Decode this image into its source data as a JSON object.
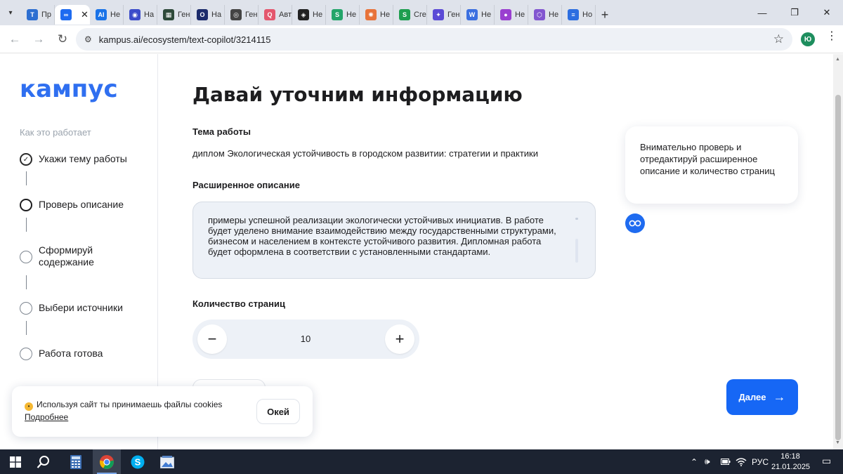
{
  "browser": {
    "tabs": [
      {
        "label": "Пр",
        "icon": "T",
        "color": "#2d6fd1"
      },
      {
        "label": "",
        "icon": "∞",
        "color": "#1e6bf0",
        "active": true
      },
      {
        "label": "Не",
        "icon": "AI",
        "color": "#1a73e8"
      },
      {
        "label": "На",
        "icon": "◉",
        "color": "#3b4cca"
      },
      {
        "label": "Ген",
        "icon": "▦",
        "color": "#2e4a3a"
      },
      {
        "label": "На",
        "icon": "O",
        "color": "#1c2b6b"
      },
      {
        "label": "Ген",
        "icon": "◎",
        "color": "#444444"
      },
      {
        "label": "Авт",
        "icon": "Q",
        "color": "#e4576e"
      },
      {
        "label": "Не",
        "icon": "◈",
        "color": "#222222"
      },
      {
        "label": "Не",
        "icon": "S",
        "color": "#24a56a"
      },
      {
        "label": "Не",
        "icon": "✺",
        "color": "#e8733a"
      },
      {
        "label": "Сге",
        "icon": "S",
        "color": "#1e9e4f"
      },
      {
        "label": "Ген",
        "icon": "✦",
        "color": "#5b4ad6"
      },
      {
        "label": "Не",
        "icon": "W",
        "color": "#3b6fe0"
      },
      {
        "label": "Не",
        "icon": "●",
        "color": "#9a3fd0"
      },
      {
        "label": "Не",
        "icon": "⬡",
        "color": "#8256d0"
      },
      {
        "label": "Но",
        "icon": "≡",
        "color": "#2d6ee0"
      }
    ],
    "url": "kampus.ai/ecosystem/text-copilot/3214115",
    "profile_initial": "Ю"
  },
  "sidebar": {
    "logo": "кампус",
    "how_it_works": "Как это работает",
    "steps": [
      {
        "label": "Укажи тему работы",
        "done": true
      },
      {
        "label": "Проверь описание",
        "current": true
      },
      {
        "label": "Сформируй содержание"
      },
      {
        "label": "Выбери источники"
      },
      {
        "label": "Работа готова"
      }
    ]
  },
  "main": {
    "title": "Давай уточним информацию",
    "topic_label": "Тема работы",
    "topic_value": "диплом Экологическая устойчивость в городском развитии: стратегии и практики",
    "description_label": "Расширенное описание",
    "description_text": "примеры успешной реализации экологически устойчивых инициатив. В работе будет уделено внимание взаимодействию между государственными структурами, бизнесом и населением в контексте устойчивого развития. Дипломная работа будет оформлена в соответствии с установленными стандартами.",
    "pages_label": "Количество страниц",
    "pages_value": "10",
    "decrement": "−",
    "increment": "+",
    "next_label": "Далее",
    "next_arrow": "→"
  },
  "assistant": {
    "tip": "Внимательно проверь и отредактируй расширенное описание и количество страниц"
  },
  "cookie": {
    "text": "Используя сайт ты принимаешь файлы cookies",
    "link": "Подробнее",
    "button": "Окей"
  },
  "taskbar": {
    "lang": "РУС",
    "time": "16:18",
    "date": "21.01.2025"
  },
  "colors": {
    "accent": "#1667f5",
    "logo": "#2f6ff0",
    "field_bg": "#edf1f7",
    "taskbar_bg": "#1c2331"
  }
}
